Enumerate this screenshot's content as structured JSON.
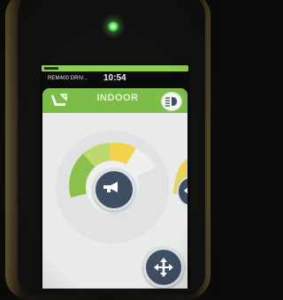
{
  "status_bar": {
    "device_name": "REM400 DRIV...",
    "time": "10:54"
  },
  "header": {
    "mode_title": "INDOOR",
    "seat_icon": "seat-recline-icon",
    "lights_icon": "headlight-icon"
  },
  "controls": {
    "horn_icon": "horn-icon",
    "move_icon": "move-arrows-icon",
    "side_icon": "arrow-left-icon"
  },
  "colors": {
    "accent_green": "#7cbc48",
    "gauge_yellow": "#f1d24a",
    "gauge_green": "#8cc04c",
    "button_fill": "#3f4f62",
    "panel_bg": "#e9ebe9"
  }
}
